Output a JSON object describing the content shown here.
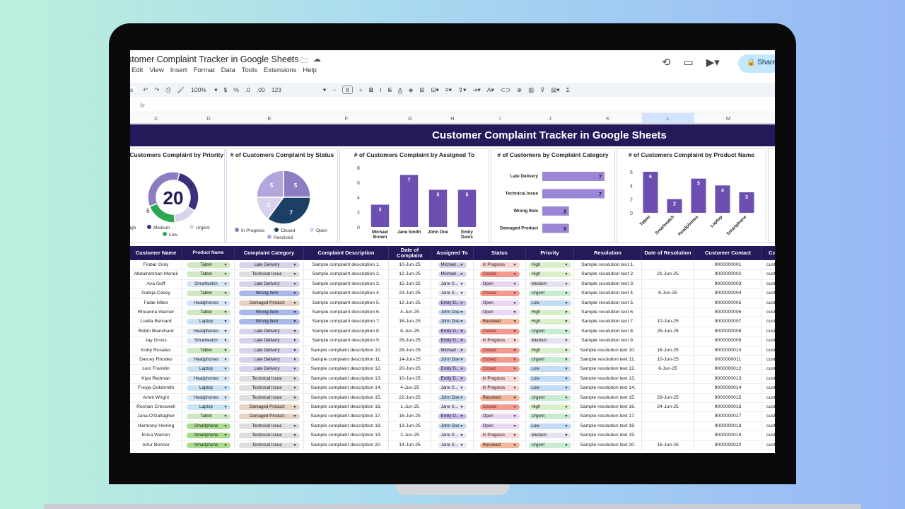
{
  "doc": {
    "title": "stomer Complaint Tracker in Google Sheets",
    "menus": [
      "Edit",
      "View",
      "Insert",
      "Format",
      "Data",
      "Tools",
      "Extensions",
      "Help"
    ],
    "share_label": "Share"
  },
  "toolbar": {
    "zoom": "100%",
    "font_size": "8",
    "currency": "$",
    "percent": "%",
    "format123": "123",
    "fx": "fx"
  },
  "columns": [
    "C",
    "D",
    "E",
    "F",
    "G",
    "H",
    "I",
    "J",
    "K",
    "L",
    "M"
  ],
  "banner": "Customer Complaint Tracker in Google Sheets",
  "panels": {
    "priority": {
      "title": "# of Customers Complaint  by Priority",
      "total": "20",
      "slices": [
        {
          "label": "High",
          "value": 7,
          "color": "#8e7cc3"
        },
        {
          "label": "Medium",
          "value": 6,
          "color": "#3c2f7e"
        },
        {
          "label": "Urgent",
          "value": 3,
          "color": "#d9d2ec"
        },
        {
          "label": "Low",
          "value": 4,
          "color": "#2ea84f"
        }
      ],
      "labels": [
        "7",
        "6"
      ]
    },
    "status": {
      "title": "# of Customers Complaint  by Status",
      "slices": [
        {
          "label": "In Progress",
          "value": 5,
          "color": "#8e7cc3"
        },
        {
          "label": "Closed",
          "value": 7,
          "color": "#1c3f66"
        },
        {
          "label": "Open",
          "value": 3,
          "color": "#d9d2ec"
        },
        {
          "label": "Resolved",
          "value": 5,
          "color": "#b3a6dc"
        }
      ]
    },
    "assigned": {
      "title": "# of Customers Complaint  by Assigned To",
      "categories": [
        "Michael Brown",
        "Jane Smith",
        "John Doe",
        "Emily Davis"
      ],
      "values": [
        3,
        7,
        5,
        5
      ],
      "yticks": [
        "8",
        "6",
        "4",
        "2",
        "0"
      ]
    },
    "category": {
      "title": "# of Customers by Complaint Category",
      "categories": [
        "Late Delivery",
        "Technical Issue",
        "Wrong Item",
        "Damaged Product"
      ],
      "values": [
        7,
        7,
        3,
        3
      ]
    },
    "product": {
      "title": "# of Customers Complaint  by Product Name",
      "categories": [
        "Tablet",
        "Smartwatch",
        "Headphones",
        "Laptop",
        "Smartphone"
      ],
      "values": [
        6,
        2,
        5,
        4,
        3
      ],
      "yticks": [
        "6",
        "4",
        "2",
        "0"
      ]
    }
  },
  "headers": [
    "Customer Name",
    "Product Name",
    "Complaint Category",
    "Complaint Description",
    "Date of Complaint",
    "Assigned To",
    "Status",
    "Priority",
    "Resolution",
    "Date of Resolution",
    "Customer Contact",
    "Cust"
  ],
  "rows": [
    [
      "Finbar Gray",
      "Tablet",
      "Late Delivery",
      "Sample complaint description 1.",
      "10-Jun-25",
      "Michael ...",
      "In Progress",
      "High",
      "Sample resolution text 1.",
      "",
      "9000000001",
      "cust"
    ],
    [
      "Abdulrahman Mcneil",
      "Tablet",
      "Technical Issue",
      "Sample complaint description 2.",
      "12-Jun-25",
      "Michael ...",
      "Closed",
      "High",
      "Sample resolution text 2.",
      "21-Jun-25",
      "9000000002",
      "cust"
    ],
    [
      "Ava Goff",
      "Smartwatch",
      "Late Delivery",
      "Sample complaint description 3.",
      "15-Jun-25",
      "Jane S...",
      "Open",
      "Medium",
      "Sample resolution text 3.",
      "",
      "9000000003",
      "cust"
    ],
    [
      "Gabija Casey",
      "Tablet",
      "Wrong Item",
      "Sample complaint description 4.",
      "23-Jun-25",
      "Jane S...",
      "Closed",
      "Urgent",
      "Sample resolution text 4.",
      "6-Jun-25",
      "9000000004",
      "cust"
    ],
    [
      "Falak Miles",
      "Headphones",
      "Damaged Product",
      "Sample complaint description 5.",
      "12-Jun-25",
      "Emily D...",
      "Open",
      "Low",
      "Sample resolution text 5.",
      "",
      "9000000005",
      "cust"
    ],
    [
      "Rheanna Warner",
      "Tablet",
      "Wrong Item",
      "Sample complaint description 6.",
      "4-Jun-25",
      "John Doe",
      "Open",
      "High",
      "Sample resolution text 6.",
      "",
      "9000000006",
      "cust"
    ],
    [
      "Luella Bernard",
      "Laptop",
      "Wrong Item",
      "Sample complaint description 7.",
      "16-Jun-25",
      "John Doe",
      "Resolved",
      "High",
      "Sample resolution text 7.",
      "10-Jun-25",
      "9000000007",
      "cust"
    ],
    [
      "Robin Blanchard",
      "Headphones",
      "Late Delivery",
      "Sample complaint description 8.",
      "8-Jun-25",
      "Emily D...",
      "Closed",
      "Urgent",
      "Sample resolution text 8.",
      "25-Jun-25",
      "9000000008",
      "cust"
    ],
    [
      "Jay Gross",
      "Smartwatch",
      "Late Delivery",
      "Sample complaint description 9.",
      "26-Jun-25",
      "Emily D...",
      "In Progress",
      "Medium",
      "Sample resolution text 9.",
      "",
      "9000000009",
      "cust"
    ],
    [
      "Koby Rosales",
      "Tablet",
      "Late Delivery",
      "Sample complaint description 10.",
      "28-Jun-25",
      "Michael ...",
      "Closed",
      "High",
      "Sample resolution text 10.",
      "16-Jun-25",
      "9000000010",
      "cust"
    ],
    [
      "Darcey Rhodes",
      "Headphones",
      "Late Delivery",
      "Sample complaint description 11.",
      "14-Jun-25",
      "John Doe",
      "Closed",
      "Urgent",
      "Sample resolution text 11.",
      "10-Jun-25",
      "9000000011",
      "cust"
    ],
    [
      "Lexi Franklin",
      "Laptop",
      "Late Delivery",
      "Sample complaint description 12.",
      "20-Jun-25",
      "Emily D...",
      "Closed",
      "Low",
      "Sample resolution text 12.",
      "6-Jun-25",
      "9000000012",
      "cust"
    ],
    [
      "Kiya Redman",
      "Headphones",
      "Technical Issue",
      "Sample complaint description 13.",
      "10-Jun-25",
      "Emily D...",
      "In Progress",
      "Low",
      "Sample resolution text 13.",
      "",
      "9000000013",
      "cust"
    ],
    [
      "Freyja Goldsmith",
      "Laptop",
      "Technical Issue",
      "Sample complaint description 14.",
      "4-Jun-25",
      "Jane S...",
      "In Progress",
      "Low",
      "Sample resolution text 14.",
      "",
      "9000000014",
      "cust"
    ],
    [
      "Amrit Wright",
      "Headphones",
      "Technical Issue",
      "Sample complaint description 15.",
      "22-Jun-25",
      "John Doe",
      "Resolved",
      "Urgent",
      "Sample resolution text 15.",
      "29-Jun-25",
      "9000000015",
      "cust"
    ],
    [
      "Roshan Cresswell",
      "Laptop",
      "Damaged Product",
      "Sample complaint description 16.",
      "1-Jun-25",
      "Jane S...",
      "Closed",
      "High",
      "Sample resolution text 16.",
      "24-Jun-25",
      "9000000016",
      "cust"
    ],
    [
      "Jana O'Gallagher",
      "Tablet",
      "Damaged Product",
      "Sample complaint description 17.",
      "16-Jun-25",
      "Emily D...",
      "Open",
      "Urgent",
      "Sample resolution text 17.",
      "",
      "9000000017",
      "cust"
    ],
    [
      "Harmony Herring",
      "Smartphone",
      "Technical Issue",
      "Sample complaint description 18.",
      "13-Jun-25",
      "John Doe",
      "Open",
      "Low",
      "Sample resolution text 18.",
      "",
      "9000000018",
      "cust"
    ],
    [
      "Erica Warren",
      "Smartphone",
      "Technical Issue",
      "Sample complaint description 19.",
      "2-Jun-25",
      "Jane S...",
      "In Progress",
      "Medium",
      "Sample resolution text 19.",
      "",
      "9000000019",
      "cust"
    ],
    [
      "Artur Bonner",
      "Smartphone",
      "Technical Issue",
      "Sample complaint description 20.",
      "14-Jun-25",
      "Jane S...",
      "Resolved",
      "Urgent",
      "Sample resolution text 20.",
      "16-Jun-25",
      "9000000020",
      "cust"
    ]
  ],
  "colors": {
    "banner": "#241a5a",
    "bar": "#6c4fb0",
    "bar_light": "#9b85d6"
  }
}
